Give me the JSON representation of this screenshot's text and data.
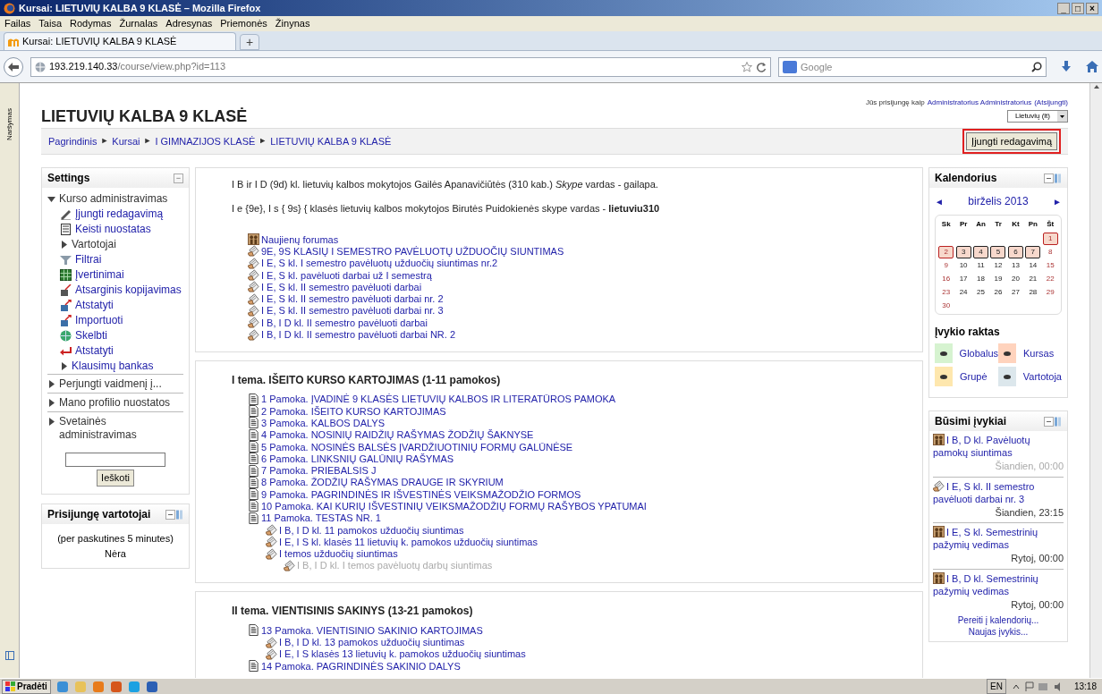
{
  "window": {
    "title": "Kursai: LIETUVIŲ KALBA 9 KLASĖ – Mozilla Firefox",
    "controls": [
      "_",
      "□",
      "×"
    ]
  },
  "menu": [
    "Failas",
    "Taisa",
    "Rodymas",
    "Žurnalas",
    "Adresynas",
    "Priemonės",
    "Žinynas"
  ],
  "tabs": [
    {
      "label": "Kursai: LIETUVIŲ KALBA 9 KLASĖ",
      "selected": true
    }
  ],
  "new_tab": "+",
  "address_bar": {
    "host": "193.219.140.33",
    "path": "/course/view.php?id=113"
  },
  "search": {
    "placeholder": "Google"
  },
  "side_tab": "Naršymas",
  "page": {
    "title": "LIETUVIŲ KALBA 9 KLASĖ",
    "login": {
      "prefix": "Jūs prisijungę kaip",
      "user": "Administratorius Administratorius",
      "logout": "(Atsijungti)"
    },
    "language": "Lietuvių (lt)",
    "breadcrumb": {
      "separator": "►",
      "items": [
        "Pagrindinis",
        "Kursai",
        "I GIMNAZIJOS KLASĖ",
        "LIETUVIŲ KALBA 9 KLASĖ"
      ]
    },
    "edit_button": {
      "label": "Įjungti redagavimą",
      "highlighted": true
    }
  },
  "settings": {
    "title": "Settings",
    "collapse": "−",
    "items": [
      {
        "label": "Kurso administravimas",
        "kind": "branch",
        "expanded": true,
        "children": [
          {
            "label": "Įjungti redagavimą",
            "kind": "edit"
          },
          {
            "label": "Keisti nuostatas",
            "kind": "settings"
          },
          {
            "label": "Vartotojai",
            "kind": "branch",
            "expanded": false
          },
          {
            "label": "Filtrai",
            "kind": "filter"
          },
          {
            "label": "Įvertinimai",
            "kind": "grades"
          },
          {
            "label": "Atsarginis kopijavimas",
            "kind": "backup"
          },
          {
            "label": "Atstatyti",
            "kind": "restore"
          },
          {
            "label": "Importuoti",
            "kind": "restore"
          },
          {
            "label": "Skelbti",
            "kind": "publish"
          },
          {
            "label": "Atstatyti",
            "kind": "reset"
          },
          {
            "label": "Klausimų bankas",
            "kind": "linkbranch",
            "expanded": false
          }
        ]
      },
      {
        "label": "Perjungti vaidmenį į...",
        "kind": "branch",
        "expanded": false
      },
      {
        "label": "Mano profilio nuostatos",
        "kind": "branch",
        "expanded": false
      },
      {
        "label": "Svetainės administravimas",
        "kind": "branch",
        "expanded": false
      }
    ],
    "search_button": "Ieškoti"
  },
  "online_users": {
    "title": "Prisijungę vartotojai",
    "period": "(per paskutines 5 minutes)",
    "value": "Nėra"
  },
  "sections": [
    {
      "paragraphs": [
        "I B ir I D (9d) kl. lietuvių kalbos mokytojos Gailės Apanavičiūtės (310 kab.) *Skype* vardas - gailapa.",
        "I e {9e}, I s { 9s} { klasės lietuvių kalbos mokytojos Birutės Puidokienės skype vardas - **lietuviu310**"
      ],
      "activities": [
        {
          "kind": "forum",
          "label": "Naujienų forumas",
          "dimmed": false
        },
        {
          "kind": "assignment",
          "label": "9E, 9S KLASIŲ I SEMESTRO PAVĖLUOTŲ UŽDUOČIŲ SIUNTIMAS",
          "dimmed": false
        },
        {
          "kind": "assignment",
          "label": "I E, S kl. I semestro pavėluotų užduočių siuntimas nr.2",
          "dimmed": false
        },
        {
          "kind": "assignment",
          "label": "I E, S kl. pavėluoti darbai už I semestrą",
          "dimmed": false
        },
        {
          "kind": "assignment",
          "label": "I E, S kl. II semestro pavėluoti darbai",
          "dimmed": false
        },
        {
          "kind": "assignment",
          "label": "I E, S kl. II semestro pavėluoti darbai nr. 2",
          "dimmed": false
        },
        {
          "kind": "assignment",
          "label": "I E, S kl. II semestro pavėluoti darbai nr. 3",
          "dimmed": false
        },
        {
          "kind": "assignment",
          "label": "I B, I D kl. II semestro pavėluoti darbai",
          "dimmed": false
        },
        {
          "kind": "assignment",
          "label": "I B, I D kl. II semestro pavėluoti darbai NR. 2",
          "dimmed": false
        }
      ]
    },
    {
      "title": "I tema. IŠEITO KURSO KARTOJIMAS (1-11 pamokos)",
      "activities": [
        {
          "kind": "resource",
          "label": "1 Pamoka. ĮVADINĖ 9 KLASĖS LIETUVIŲ KALBOS IR LITERATŪROS PAMOKA",
          "dimmed": false
        },
        {
          "kind": "resource",
          "label": "2 Pamoka. IŠEITO KURSO KARTOJIMAS",
          "dimmed": false
        },
        {
          "kind": "resource",
          "label": "3 Pamoka. KALBOS DALYS",
          "dimmed": false
        },
        {
          "kind": "resource",
          "label": "4 Pamoka. NOSINIŲ RAIDŽIŲ RAŠYMAS ŽODŽIŲ ŠAKNYSE",
          "dimmed": false
        },
        {
          "kind": "resource",
          "label": "5 Pamoka. NOSINĖS BALSĖS ĮVARDŽIUOTINIŲ FORMŲ GALŪNĖSE",
          "dimmed": false
        },
        {
          "kind": "resource",
          "label": "6 Pamoka. LINKSNIŲ GALŪNIŲ RAŠYMAS",
          "dimmed": false
        },
        {
          "kind": "resource",
          "label": "7 Pamoka. PRIEBALSIS J",
          "dimmed": false
        },
        {
          "kind": "resource",
          "label": "8 Pamoka. ŽODŽIŲ RAŠYMAS DRAUGE IR SKYRIUM",
          "dimmed": false
        },
        {
          "kind": "resource",
          "label": "9 Pamoka. PAGRINDINĖS IR IŠVESTINĖS VEIKSMAŽODŽIO FORMOS",
          "dimmed": false
        },
        {
          "kind": "resource",
          "label": "10 Pamoka. KAI KURIŲ IŠVESTINIŲ VEIKSMAŽODŽIŲ FORMŲ RAŠYBOS YPATUMAI",
          "dimmed": false
        },
        {
          "kind": "resource",
          "label": "11 Pamoka. TESTAS NR. 1",
          "dimmed": false,
          "children": [
            {
              "kind": "assignment",
              "label": "I B, I D kl. 11 pamokos užduočių siuntimas",
              "dimmed": false
            },
            {
              "kind": "assignment",
              "label": "I E, I S kl. klasės 11 lietuvių k. pamokos užduočių siuntimas",
              "dimmed": false
            },
            {
              "kind": "assignment",
              "label": "I temos užduočių siuntimas",
              "dimmed": false,
              "children": [
                {
                  "kind": "assignment",
                  "label": "I B, I D kl. I temos pavėluotų darbų siuntimas",
                  "dimmed": true
                }
              ]
            }
          ]
        }
      ]
    },
    {
      "title": "II tema. VIENTISINIS SAKINYS (13-21 pamokos)",
      "activities": [
        {
          "kind": "resource",
          "label": "13 Pamoka. VIENTISINIO SAKINIO KARTOJIMAS",
          "dimmed": false,
          "children": [
            {
              "kind": "assignment",
              "label": "I B, I D kl. 13 pamokos užduočių siuntimas",
              "dimmed": false
            },
            {
              "kind": "assignment",
              "label": "I E, I S klasės 13 lietuvių k. pamokos užduočių siuntimas",
              "dimmed": false
            }
          ]
        },
        {
          "kind": "resource",
          "label": "14 Pamoka. PAGRINDINĖS SAKINIO DALYS",
          "dimmed": false
        }
      ]
    }
  ],
  "calendar": {
    "title": "Kalendorius",
    "prev": "◄",
    "next": "►",
    "month": "birželis 2013",
    "weekdays": [
      "Sk",
      "Pr",
      "An",
      "Tr",
      "Kt",
      "Pn",
      "Št"
    ],
    "weeks": [
      [
        {
          "day": "1",
          "event": true
        }
      ],
      [
        {
          "day": "2",
          "event": true
        },
        {
          "day": "3",
          "event": true
        },
        {
          "day": "4",
          "event": true
        },
        {
          "day": "5",
          "event": true
        },
        {
          "day": "6",
          "event": true
        },
        {
          "day": "7",
          "event": true
        },
        {
          "day": "8",
          "event": false
        }
      ],
      [
        {
          "day": "9",
          "event": false
        },
        {
          "day": "10",
          "event": false
        },
        {
          "day": "11",
          "event": false
        },
        {
          "day": "12",
          "event": false
        },
        {
          "day": "13",
          "event": false
        },
        {
          "day": "14",
          "event": false
        },
        {
          "day": "15",
          "event": false
        }
      ],
      [
        {
          "day": "16",
          "event": false
        },
        {
          "day": "17",
          "event": false
        },
        {
          "day": "18",
          "event": false
        },
        {
          "day": "19",
          "event": false
        },
        {
          "day": "20",
          "event": false
        },
        {
          "day": "21",
          "event": false
        },
        {
          "day": "22",
          "event": false
        }
      ],
      [
        {
          "day": "23",
          "event": false
        },
        {
          "day": "24",
          "event": false
        },
        {
          "day": "25",
          "event": false
        },
        {
          "day": "26",
          "event": false
        },
        {
          "day": "27",
          "event": false
        },
        {
          "day": "28",
          "event": false
        },
        {
          "day": "29",
          "event": false
        }
      ],
      [
        {
          "day": "30",
          "event": false
        }
      ]
    ],
    "key_title": "Įvykio raktas",
    "key": [
      {
        "label": "Globalus",
        "color": "#d6f3d0"
      },
      {
        "label": "Kursas",
        "color": "#ffd3bd"
      },
      {
        "label": "Grupė",
        "color": "#fee7ae"
      },
      {
        "label": "Vartotoja",
        "color": "#dce7ec"
      }
    ]
  },
  "upcoming": {
    "title": "Būsimi įvykiai",
    "events": [
      {
        "kind": "forum",
        "title": "I B, D kl. Pavėluotų pamokų siuntimas",
        "time": "Šiandien, 00:00",
        "dimmed": true
      },
      {
        "kind": "assignment",
        "title": "I E, S kl. II semestro pavėluoti darbai nr. 3",
        "time": "Šiandien, 23:15",
        "dimmed": false
      },
      {
        "kind": "forum",
        "title": "I E, S kl. Semestrinių pažymių vedimas",
        "time": "Rytoj, 00:00",
        "dimmed": false
      },
      {
        "kind": "forum",
        "title": "I B, D kl. Semestrinių pažymių vedimas",
        "time": "Rytoj, 00:00",
        "dimmed": false
      }
    ],
    "links": [
      "Pereiti į kalendorių...",
      "Naujas įvykis..."
    ]
  },
  "taskbar": {
    "start": "Pradėti",
    "language": "EN",
    "clock": "13:18"
  }
}
